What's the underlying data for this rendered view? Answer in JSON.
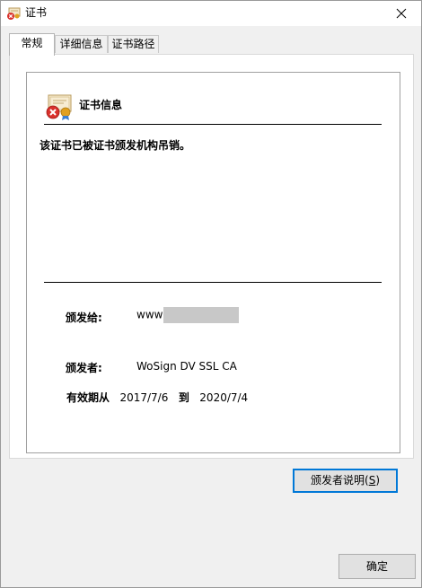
{
  "window": {
    "title": "证书",
    "icon": "certificate-error-icon",
    "close_icon": "close-icon"
  },
  "tabs": [
    {
      "label": "常规",
      "active": true
    },
    {
      "label": "详细信息",
      "active": false
    },
    {
      "label": "证书路径",
      "active": false
    }
  ],
  "general": {
    "info_title": "证书信息",
    "status_message": "该证书已被证书颁发机构吊销。",
    "issued_to_label": "颁发给:",
    "issued_to_value": "www",
    "issued_by_label": "颁发者:",
    "issued_by_value": "WoSign DV SSL CA",
    "validity_label": "有效期从",
    "valid_from": "2017/7/6",
    "to_label": "到",
    "valid_to": "2020/7/4"
  },
  "buttons": {
    "issuer_statement_text": "颁发者说明(",
    "issuer_statement_mnemonic": "S",
    "issuer_statement_close": ")",
    "ok_label": "确定"
  },
  "colors": {
    "focus_border": "#0078d7",
    "error_red": "#d9302b",
    "seal_gold": "#e0a020"
  }
}
